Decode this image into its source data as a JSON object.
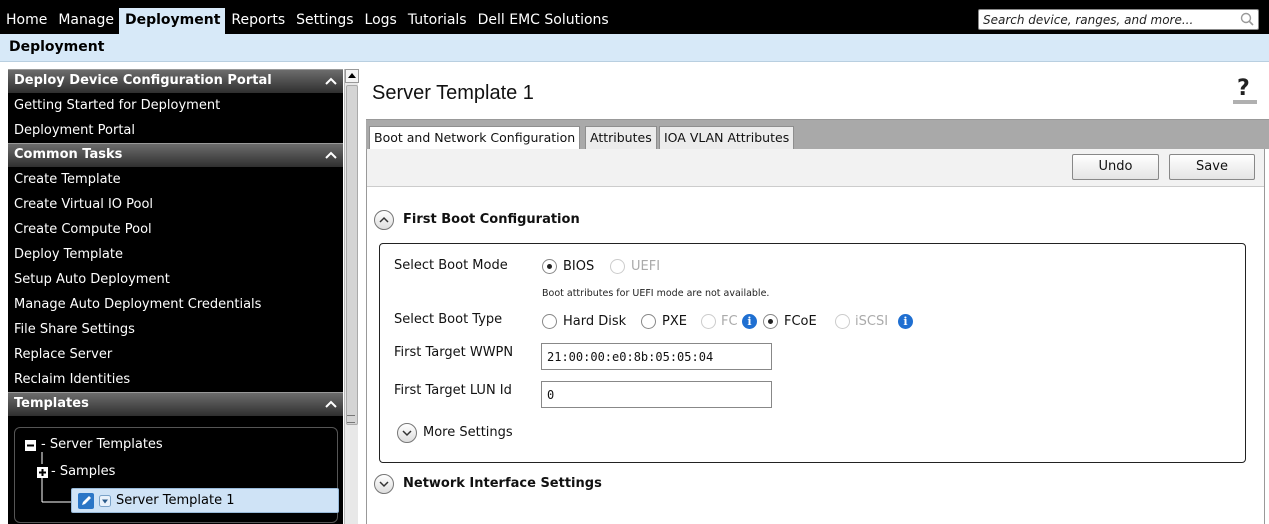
{
  "menu": {
    "items": [
      "Home",
      "Manage",
      "Deployment",
      "Reports",
      "Settings",
      "Logs",
      "Tutorials",
      "Dell EMC Solutions"
    ],
    "active": "Deployment"
  },
  "search": {
    "placeholder": "Search device, ranges, and more..."
  },
  "subbar": {
    "title": "Deployment"
  },
  "sidebar": {
    "portal_header": "Deploy Device Configuration Portal",
    "portal_items": [
      "Getting Started for Deployment",
      "Deployment Portal"
    ],
    "tasks_header": "Common Tasks",
    "tasks_items": [
      "Create Template",
      "Create Virtual IO Pool",
      "Create Compute Pool",
      "Deploy Template",
      "Setup Auto Deployment",
      "Manage Auto Deployment Credentials",
      "File Share Settings",
      "Replace Server",
      "Reclaim Identities"
    ],
    "templates_header": "Templates",
    "tree": {
      "root": "Server Templates",
      "samples": "Samples",
      "selected": "Server Template 1"
    }
  },
  "main": {
    "title": "Server Template 1",
    "tabs": [
      "Boot and Network Configuration",
      "Attributes",
      "IOA VLAN Attributes"
    ],
    "undo_label": "Undo",
    "save_label": "Save",
    "first_boot": {
      "heading": "First Boot Configuration",
      "boot_mode_label": "Select Boot Mode",
      "boot_mode_options": [
        "BIOS",
        "UEFI"
      ],
      "boot_mode_selected": "BIOS",
      "uefi_note": "Boot attributes for UEFI mode are not available.",
      "boot_type_label": "Select Boot Type",
      "boot_type_options": [
        "Hard Disk",
        "PXE",
        "FC",
        "FCoE",
        "iSCSI"
      ],
      "boot_type_selected": "FCoE",
      "wwpn_label": "First Target WWPN",
      "wwpn_value": "21:00:00:e0:8b:05:05:04",
      "lun_label": "First Target LUN Id",
      "lun_value": "0",
      "more_settings": "More Settings"
    },
    "network_heading": "Network Interface Settings"
  },
  "colors": {
    "menu_bg": "#000000",
    "active_menu": "#d7e9f8",
    "info_blue": "#1f6fd1"
  }
}
